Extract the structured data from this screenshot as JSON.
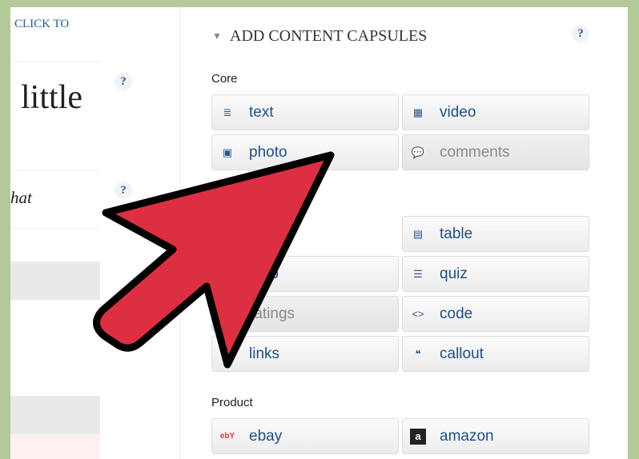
{
  "left": {
    "click_to": "CLICK TO",
    "title_fragment": "little",
    "italic_fragment": "hat",
    "help": "?"
  },
  "capsules": {
    "title": "ADD CONTENT CAPSULES",
    "help": "?",
    "sections": [
      {
        "label": "Core",
        "items": [
          {
            "label": "text",
            "icon": "text-icon"
          },
          {
            "label": "video",
            "icon": "film-icon"
          },
          {
            "label": "photo",
            "icon": "photo-icon"
          },
          {
            "label": "comments",
            "icon": "comments-icon",
            "disabled": true
          }
        ]
      },
      {
        "label": "",
        "items": [
          {
            "label": "",
            "icon": ""
          },
          {
            "label": "table",
            "icon": "table-icon"
          },
          {
            "label": "map",
            "icon": "map-icon"
          },
          {
            "label": "quiz",
            "icon": "quiz-icon"
          },
          {
            "label": "ratings",
            "icon": "ratings-icon",
            "disabled": true
          },
          {
            "label": "code",
            "icon": "code-icon"
          },
          {
            "label": "links",
            "icon": "links-icon"
          },
          {
            "label": "callout",
            "icon": "callout-icon"
          }
        ]
      },
      {
        "label": "Product",
        "items": [
          {
            "label": "ebay",
            "icon": "ebay-icon"
          },
          {
            "label": "amazon",
            "icon": "amazon-icon"
          }
        ]
      }
    ]
  },
  "colors": {
    "arrow": "#dc2f42",
    "background": "#b3c99a",
    "link": "#1f4f86"
  }
}
